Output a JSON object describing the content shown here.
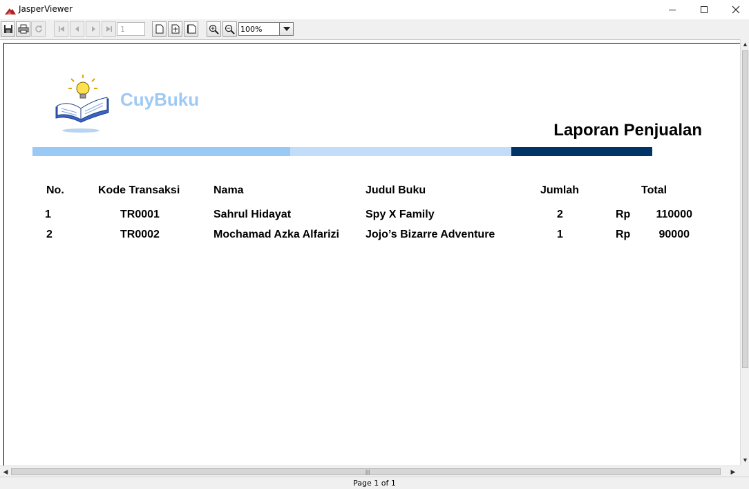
{
  "window": {
    "title": "JasperViewer"
  },
  "toolbar": {
    "page_number": "1",
    "zoom": "100%"
  },
  "report": {
    "brand": "CuyBuku",
    "title": "Laporan Penjualan",
    "colors": {
      "bar_light": "#99c9f5",
      "bar_lighter": "#c2ddfa",
      "bar_dark": "#003366",
      "brand": "#9ec9f3"
    },
    "headers": {
      "no": "No.",
      "kode": "Kode Transaksi",
      "nama": "Nama",
      "judul": "Judul Buku",
      "jumlah": "Jumlah",
      "total": "Total"
    },
    "rows": [
      {
        "no": "1",
        "kode": "TR0001",
        "nama": "Sahrul Hidayat",
        "judul": "Spy X Family",
        "jumlah": "2",
        "currency": "Rp",
        "total": "110000"
      },
      {
        "no": "2",
        "kode": "TR0002",
        "nama": "Mochamad Azka Alfarizi",
        "judul": "Jojo’s Bizarre Adventure",
        "jumlah": "1",
        "currency": "Rp",
        "total": "90000"
      }
    ]
  },
  "status": {
    "page_info": "Page 1 of 1"
  }
}
